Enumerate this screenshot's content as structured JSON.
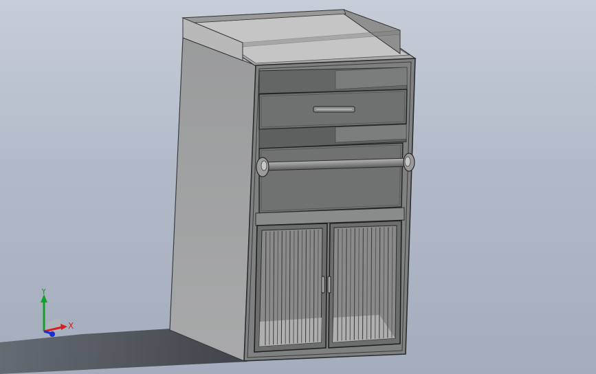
{
  "triad": {
    "y_label": "Y",
    "x_label": "X",
    "y_color": "#16a02a",
    "x_color": "#d42020",
    "z_color": "#1a2fd0"
  },
  "model": {
    "name": "cabinet-assembly",
    "parts": [
      "top-tray",
      "side-panel",
      "front-frame",
      "drawer",
      "drawer-handle",
      "open-compartment",
      "towel-bar",
      "towel-bar-brackets",
      "left-door",
      "right-door",
      "door-handles",
      "door-grilles"
    ]
  }
}
